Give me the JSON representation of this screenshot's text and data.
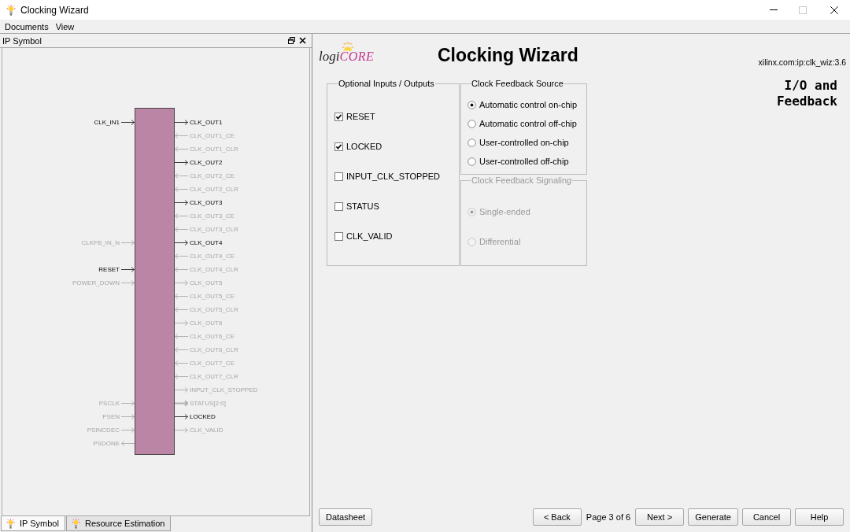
{
  "window": {
    "title": "Clocking Wizard",
    "maximize_disabled": true
  },
  "menu": [
    "Documents",
    "View"
  ],
  "left_panel": {
    "title": "IP Symbol",
    "symbol": {
      "rows": [
        {
          "left": {
            "label": "CLK_IN1",
            "kind": "input",
            "active": true
          },
          "right": {
            "label": "CLK_OUT1",
            "kind": "output",
            "active": true
          }
        },
        {
          "right": {
            "label": "CLK_OUT1_CE",
            "kind": "input",
            "active": false
          }
        },
        {
          "right": {
            "label": "CLK_OUT1_CLR",
            "kind": "input",
            "active": false
          }
        },
        {
          "right": {
            "label": "CLK_OUT2",
            "kind": "output",
            "active": true
          }
        },
        {
          "right": {
            "label": "CLK_OUT2_CE",
            "kind": "input",
            "active": false
          }
        },
        {
          "right": {
            "label": "CLK_OUT2_CLR",
            "kind": "input",
            "active": false
          }
        },
        {
          "right": {
            "label": "CLK_OUT3",
            "kind": "output",
            "active": true
          }
        },
        {
          "right": {
            "label": "CLK_OUT3_CE",
            "kind": "input",
            "active": false
          }
        },
        {
          "right": {
            "label": "CLK_OUT3_CLR",
            "kind": "input",
            "active": false
          }
        },
        {
          "left": {
            "label": "CLKFB_IN_N",
            "kind": "input",
            "active": false
          },
          "right": {
            "label": "CLK_OUT4",
            "kind": "output",
            "active": true
          }
        },
        {
          "right": {
            "label": "CLK_OUT4_CE",
            "kind": "input",
            "active": false
          }
        },
        {
          "left": {
            "label": "RESET",
            "kind": "input",
            "active": true
          },
          "right": {
            "label": "CLK_OUT4_CLR",
            "kind": "input",
            "active": false
          }
        },
        {
          "left": {
            "label": "POWER_DOWN",
            "kind": "input",
            "active": false
          },
          "right": {
            "label": "CLK_OUT5",
            "kind": "output",
            "active": false
          }
        },
        {
          "right": {
            "label": "CLK_OUT5_CE",
            "kind": "input",
            "active": false
          }
        },
        {
          "right": {
            "label": "CLK_OUT5_CLR",
            "kind": "input",
            "active": false
          }
        },
        {
          "right": {
            "label": "CLK_OUT6",
            "kind": "output",
            "active": false
          }
        },
        {
          "right": {
            "label": "CLK_OUT6_CE",
            "kind": "input",
            "active": false
          }
        },
        {
          "right": {
            "label": "CLK_OUT6_CLR",
            "kind": "input",
            "active": false
          }
        },
        {
          "right": {
            "label": "CLK_OUT7_CE",
            "kind": "input",
            "active": false
          }
        },
        {
          "right": {
            "label": "CLK_OUT7_CLR",
            "kind": "input",
            "active": false
          }
        },
        {
          "right": {
            "label": "INPUT_CLK_STOPPED",
            "kind": "output",
            "active": false
          }
        },
        {
          "left": {
            "label": "PSCLK",
            "kind": "input",
            "active": false
          },
          "right": {
            "label": "STATUS[2:0]",
            "kind": "bus",
            "active": false
          }
        },
        {
          "left": {
            "label": "PSEN",
            "kind": "input",
            "active": false
          },
          "right": {
            "label": "LOCKED",
            "kind": "output",
            "active": true
          }
        },
        {
          "left": {
            "label": "PSINCDEC",
            "kind": "input",
            "active": false
          },
          "right": {
            "label": "CLK_VALID",
            "kind": "output",
            "active": false
          }
        },
        {
          "left": {
            "label": "PSDONE",
            "kind": "output",
            "active": false
          }
        }
      ]
    },
    "tabs": [
      {
        "label": "IP Symbol",
        "selected": true
      },
      {
        "label": "Resource Estimation",
        "selected": false
      }
    ]
  },
  "right_panel": {
    "logo": {
      "prefix": "logi",
      "suffix": "CORE"
    },
    "title": "Clocking Wizard",
    "ip_id": "xilinx.com:ip:clk_wiz:3.6",
    "page_heading": "I/O and Feedback",
    "optional_io": {
      "title": "Optional Inputs / Outputs",
      "items": [
        {
          "label": "RESET",
          "checked": true
        },
        {
          "label": "LOCKED",
          "checked": true
        },
        {
          "label": "INPUT_CLK_STOPPED",
          "checked": false
        },
        {
          "label": "STATUS",
          "checked": false
        },
        {
          "label": "CLK_VALID",
          "checked": false
        }
      ]
    },
    "feedback_groups": [
      {
        "title": "Clock Feedback Source",
        "disabled": false,
        "options": [
          {
            "label": "Automatic control on-chip",
            "selected": true
          },
          {
            "label": "Automatic control off-chip",
            "selected": false
          },
          {
            "label": "User-controlled on-chip",
            "selected": false
          },
          {
            "label": "User-controlled off-chip",
            "selected": false
          }
        ]
      },
      {
        "title": "Clock Feedback Signaling",
        "disabled": true,
        "options": [
          {
            "label": "Single-ended",
            "selected": true
          },
          {
            "label": "Differential",
            "selected": false
          }
        ]
      }
    ]
  },
  "footer": {
    "left": [
      {
        "kind": "button",
        "label": "Datasheet"
      }
    ],
    "right": [
      {
        "kind": "button",
        "label": "< Back"
      },
      {
        "kind": "text",
        "label": "Page 3 of 6"
      },
      {
        "kind": "button",
        "label": "Next >"
      },
      {
        "kind": "button",
        "label": "Generate"
      },
      {
        "kind": "button",
        "label": "Cancel"
      },
      {
        "kind": "button",
        "label": "Help"
      }
    ]
  }
}
